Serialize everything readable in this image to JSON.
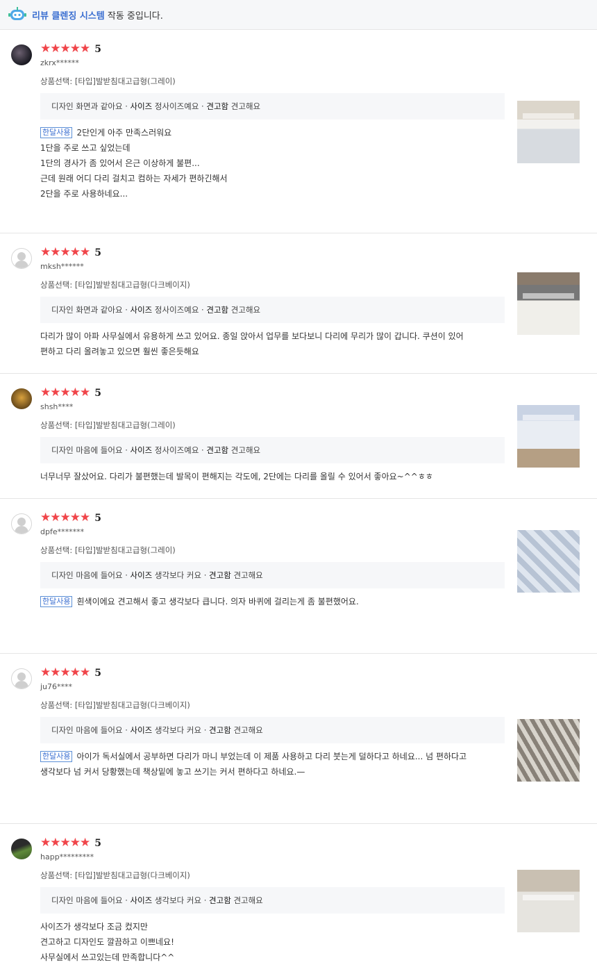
{
  "topbar": {
    "highlight": "리뷰 클렌징 시스템",
    "rest": " 작동 중입니다."
  },
  "rating_max_stars": 5,
  "reviews": [
    {
      "score": "5",
      "user": "zkrx******",
      "option": "상품선택: [타입]발받침대고급형(그레이)",
      "survey": {
        "q1": "디자인",
        "a1": "화면과 같아요",
        "q2": "사이즈",
        "a2": "정사이즈예요",
        "q3": "견고함",
        "a3": "견고해요"
      },
      "badge": "한달사용",
      "lines": [
        "2단인게 아주 만족스러워요",
        "1단을 주로 쓰고 싶었는데",
        "1단의 경사가 좀 있어서 은근 이상하게 불편...",
        "근데 원래 어디 다리 걸치고 컴하는 자세가 편하긴해서",
        "2단을 주로 사용하네요..."
      ]
    },
    {
      "score": "5",
      "user": "mksh******",
      "option": "상품선택: [타입]발받침대고급형(다크베이지)",
      "survey": {
        "q1": "디자인",
        "a1": "화면과 같아요",
        "q2": "사이즈",
        "a2": "정사이즈예요",
        "q3": "견고함",
        "a3": "견고해요"
      },
      "badge": "",
      "lines": [
        "다리가 많이 아파 사무실에서 유용하게 쓰고 있어요. 종일 앉아서 업무를 보다보니 다리에 무리가 많이 갑니다. 쿠션이 있어",
        "편하고 다리 올려놓고 있으면 훨씬 좋은듯해요"
      ]
    },
    {
      "score": "5",
      "user": "shsh****",
      "option": "상품선택: [타입]발받침대고급형(그레이)",
      "survey": {
        "q1": "디자인",
        "a1": "마음에 들어요",
        "q2": "사이즈",
        "a2": "정사이즈예요",
        "q3": "견고함",
        "a3": "견고해요"
      },
      "badge": "",
      "lines": [
        "너무너무 잘샀어요. 다리가 불편했는데 발목이 편해지는 각도에, 2단에는 다리를 올릴 수 있어서 좋아요~^^ㅎㅎ"
      ]
    },
    {
      "score": "5",
      "user": "dpfe*******",
      "option": "상품선택: [타입]발받침대고급형(그레이)",
      "survey": {
        "q1": "디자인",
        "a1": "마음에 들어요",
        "q2": "사이즈",
        "a2": "생각보다 커요",
        "q3": "견고함",
        "a3": "견고해요"
      },
      "badge": "한달사용",
      "lines": [
        "흰색이에요 견고해서 좋고 생각보다 큽니다. 의자 바퀴에 걸리는게 좀 불편했어요."
      ]
    },
    {
      "score": "5",
      "user": "ju76****",
      "option": "상품선택: [타입]발받침대고급형(다크베이지)",
      "survey": {
        "q1": "디자인",
        "a1": "마음에 들어요",
        "q2": "사이즈",
        "a2": "생각보다 커요",
        "q3": "견고함",
        "a3": "견고해요"
      },
      "badge": "한달사용",
      "lines": [
        "아이가 독서실에서 공부하면 다리가 마니 부었는데 이 제품 사용하고 다리 붓는게 덜하다고 하네요... 넘 편하다고",
        "생각보다 넘 커서 당황했는데 책상밑에 놓고 쓰기는 커서 편하다고 하네요.—"
      ]
    },
    {
      "score": "5",
      "user": "happ*********",
      "option": "상품선택: [타입]발받침대고급형(다크베이지)",
      "survey": {
        "q1": "디자인",
        "a1": "마음에 들어요",
        "q2": "사이즈",
        "a2": "생각보다 커요",
        "q3": "견고함",
        "a3": "견고해요"
      },
      "badge": "",
      "lines": [
        "사이즈가 생각보다 조금 컸지만",
        "견고하고 디자인도 깔끔하고 이쁘네요!",
        "사무실에서 쓰고있는데 만족합니다^^"
      ]
    }
  ]
}
